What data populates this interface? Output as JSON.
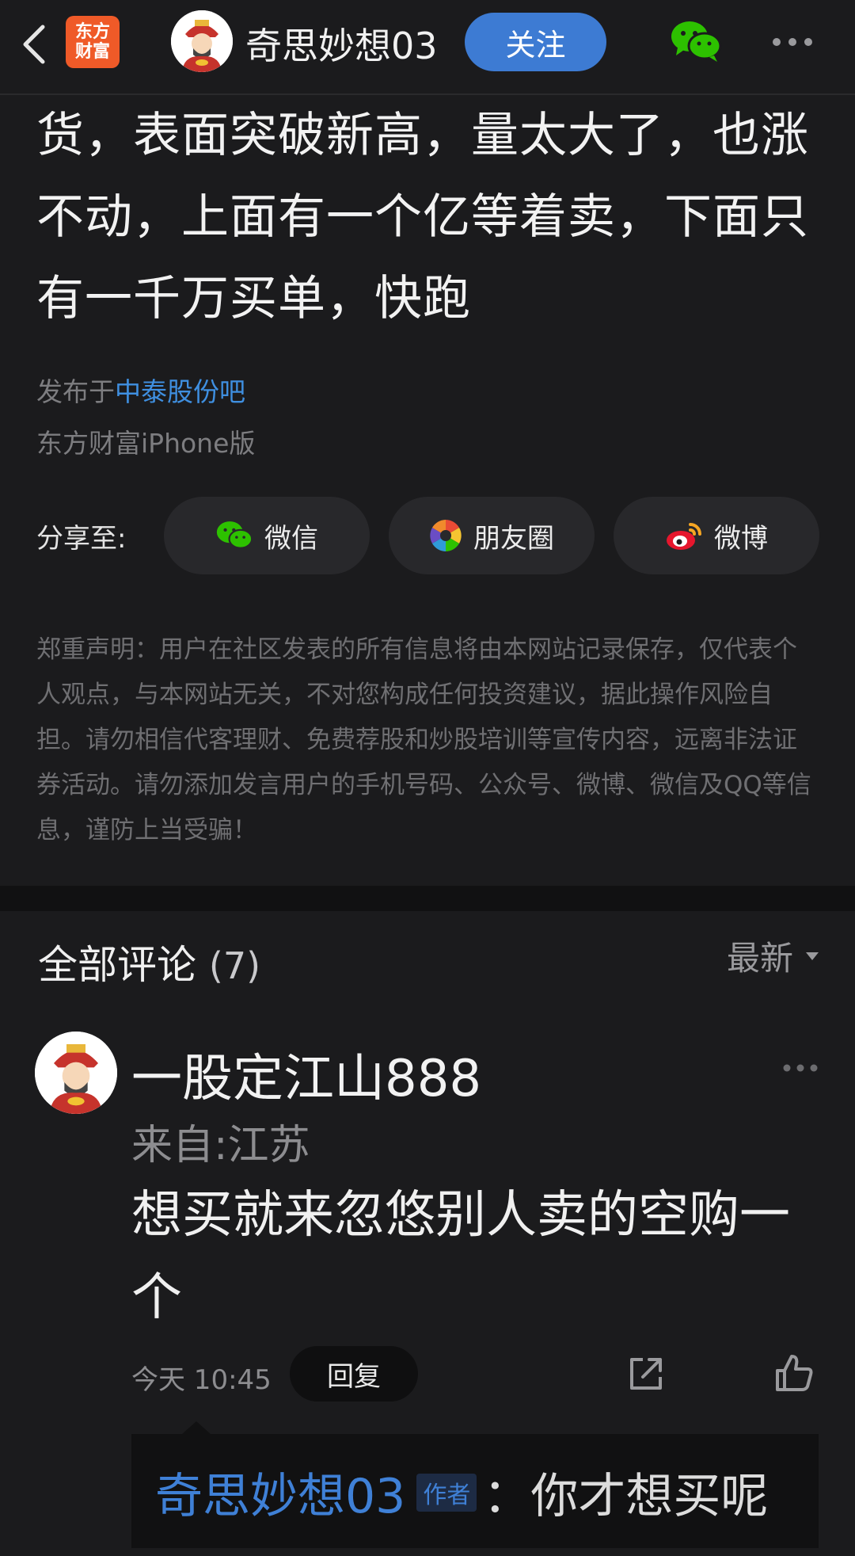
{
  "header": {
    "logo_line1": "东方",
    "logo_line2": "财富",
    "username": "奇思妙想03",
    "follow_label": "关注"
  },
  "post": {
    "body": "货，表面突破新高，量太大了，也涨不动，上面有一个亿等着卖，下面只有一千万买单，快跑",
    "published_prefix": "发布于",
    "bar_name": "中泰股份吧",
    "client": "东方财富iPhone版"
  },
  "share": {
    "label": "分享至:",
    "wechat": "微信",
    "moments": "朋友圈",
    "weibo": "微博"
  },
  "disclaimer": "郑重声明：用户在社区发表的所有信息将由本网站记录保存，仅代表个人观点，与本网站无关，不对您构成任何投资建议，据此操作风险自担。请勿相信代客理财、免费荐股和炒股培训等宣传内容，远离非法证券活动。请勿添加发言用户的手机号码、公众号、微博、微信及QQ等信息，谨防上当受骗！",
  "comments": {
    "title": "全部评论",
    "count": "(7)",
    "sort_label": "最新",
    "items": [
      {
        "user": "一股定江山888",
        "location": "来自:江苏",
        "text": "想买就来忽悠别人卖的空购一个",
        "time": "今天 10:45",
        "reply_label": "回复",
        "reply": {
          "author": "奇思妙想03",
          "author_tag": "作者",
          "text": "：你才想买呢"
        }
      }
    ]
  },
  "colors": {
    "background": "#1b1b1d",
    "accent_blue": "#3d7bd3",
    "brand_orange": "#ef5a28"
  }
}
